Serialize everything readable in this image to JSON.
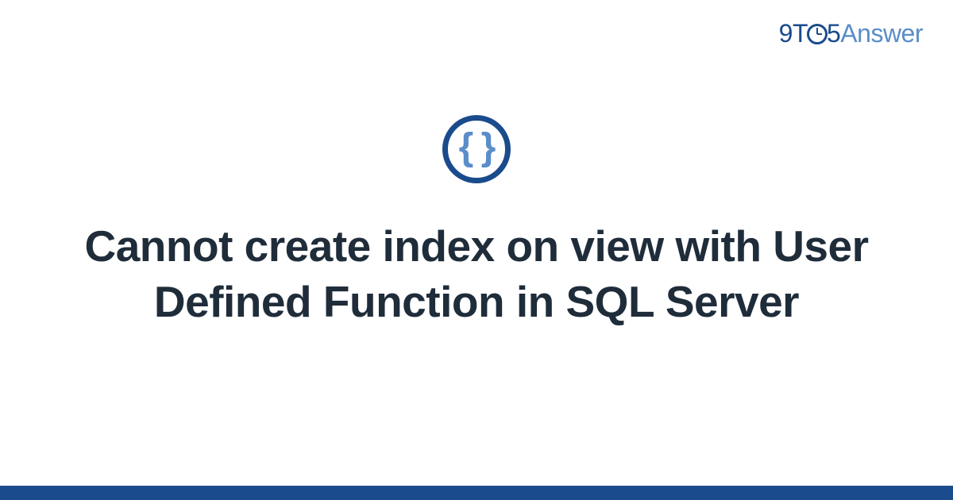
{
  "logo": {
    "part1": "9",
    "part2": "T",
    "part3": "5",
    "part4": "Answer"
  },
  "icon": {
    "glyph": "{ }",
    "name": "code-braces-icon"
  },
  "title": "Cannot create index on view with User Defined Function in SQL Server",
  "colors": {
    "primary": "#1a4b8c",
    "secondary": "#5a8dc9",
    "text": "#1f2c3a"
  }
}
